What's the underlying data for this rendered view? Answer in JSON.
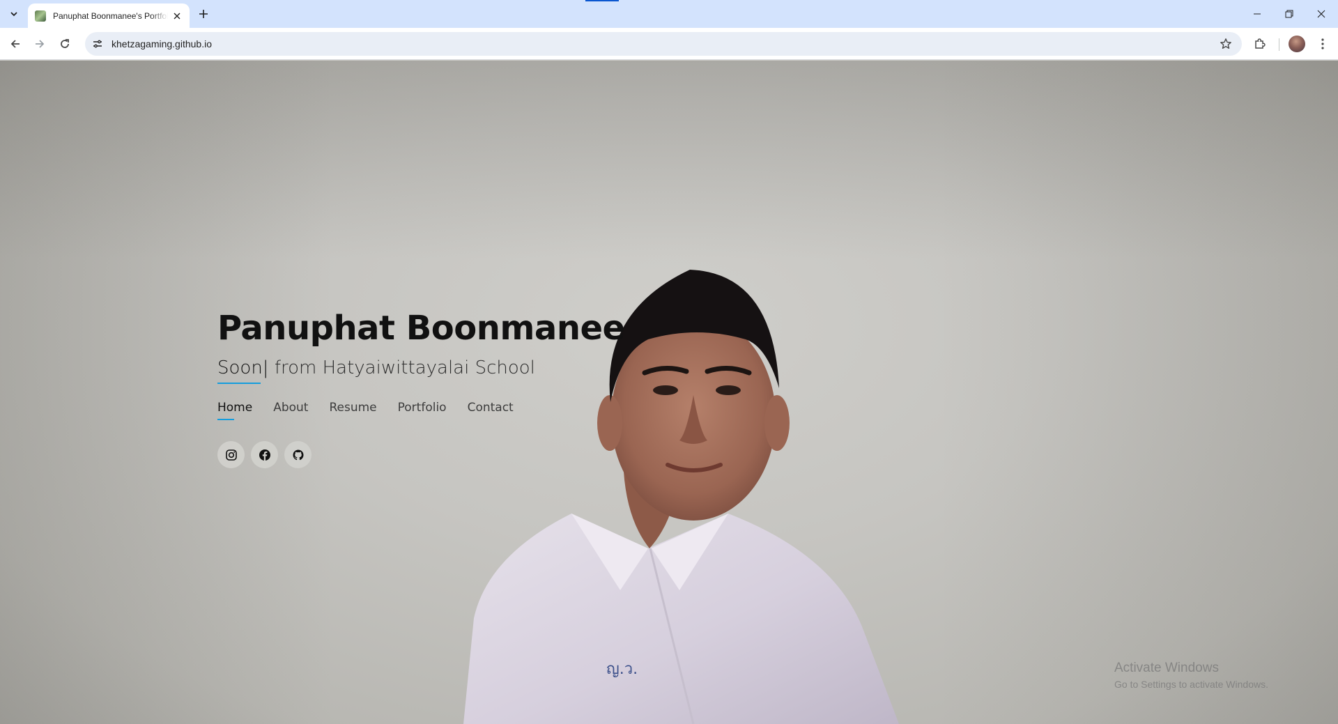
{
  "browser": {
    "tab_title": "Panuphat Boonmanee's Portfolio",
    "url": "khetzagaming.github.io"
  },
  "hero": {
    "name": "Panuphat Boonmanee",
    "typed_text": "Soon",
    "caret": "|",
    "subtitle_rest": " from Hatyaiwittayalai School"
  },
  "nav": {
    "items": [
      {
        "label": "Home",
        "active": true
      },
      {
        "label": "About",
        "active": false
      },
      {
        "label": "Resume",
        "active": false
      },
      {
        "label": "Portfolio",
        "active": false
      },
      {
        "label": "Contact",
        "active": false
      }
    ]
  },
  "social": {
    "items": [
      {
        "icon": "instagram-icon"
      },
      {
        "icon": "facebook-icon"
      },
      {
        "icon": "github-icon"
      }
    ]
  },
  "watermark": {
    "title": "Activate Windows",
    "subtitle": "Go to Settings to activate Windows."
  },
  "colors": {
    "accent": "#149ddd",
    "tabbar": "#d3e3fd",
    "omnibox": "#e9eef6"
  }
}
